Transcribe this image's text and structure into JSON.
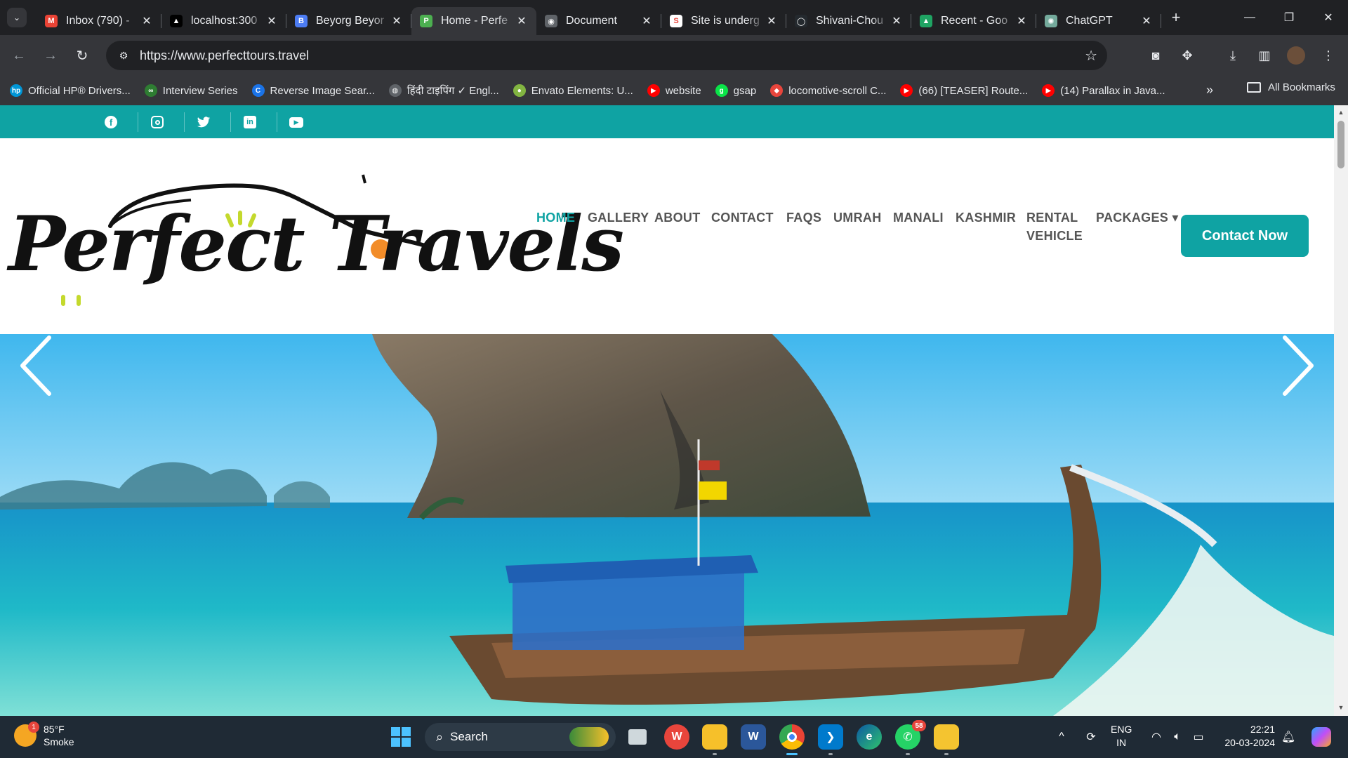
{
  "browser": {
    "tabs": [
      {
        "label": "Inbox (790) -",
        "favicon": "gmail-icon",
        "color": "#ea4335",
        "glyph": "M"
      },
      {
        "label": "localhost:300",
        "favicon": "vercel-triangle-icon",
        "color": "#000000",
        "glyph": "▲"
      },
      {
        "label": "Beyorg Beyor",
        "favicon": "beyorg-icon",
        "color": "#4c7cf3",
        "glyph": "B"
      },
      {
        "label": "Home - Perfe",
        "favicon": "perfect-travels-icon",
        "color": "#4caf50",
        "glyph": "P",
        "active": true
      },
      {
        "label": "Document",
        "favicon": "globe-icon",
        "color": "#5f6368",
        "glyph": "◉"
      },
      {
        "label": "Site is underg",
        "favicon": "site-icon",
        "color": "#ffffff",
        "glyph": "S"
      },
      {
        "label": "Shivani-Chou",
        "favicon": "github-icon",
        "color": "#24292e",
        "glyph": "◯"
      },
      {
        "label": "Recent - Goo",
        "favicon": "google-drive-icon",
        "color": "#1fa463",
        "glyph": "▲"
      },
      {
        "label": "ChatGPT",
        "favicon": "chatgpt-icon",
        "color": "#74aa9c",
        "glyph": "✺"
      }
    ],
    "url": "https://www.perfecttours.travel",
    "bookmarks": [
      {
        "label": "Official HP® Drivers...",
        "icon": "hp-icon",
        "color": "#0096d6",
        "glyph": "hp"
      },
      {
        "label": "Interview Series",
        "icon": "interview-icon",
        "color": "#2e7d32",
        "glyph": "∞"
      },
      {
        "label": "Reverse Image Sear...",
        "icon": "reverse-image-icon",
        "color": "#1a73e8",
        "glyph": "C"
      },
      {
        "label": "हिंदी टाइपिंग ✓ Engl...",
        "icon": "hindi-typing-icon",
        "color": "#5f6368",
        "glyph": "◍"
      },
      {
        "label": "Envato Elements: U...",
        "icon": "envato-icon",
        "color": "#82b541",
        "glyph": "●"
      },
      {
        "label": "website",
        "icon": "youtube-icon",
        "color": "#ff0000",
        "glyph": "▶"
      },
      {
        "label": "gsap",
        "icon": "gsap-icon",
        "color": "#0ae448",
        "glyph": "g"
      },
      {
        "label": "locomotive-scroll C...",
        "icon": "locomotive-icon",
        "color": "#e8453c",
        "glyph": "◆"
      },
      {
        "label": "(66) [TEASER] Route...",
        "icon": "youtube-icon",
        "color": "#ff0000",
        "glyph": "▶"
      },
      {
        "label": "(14) Parallax in Java...",
        "icon": "youtube-icon",
        "color": "#ff0000",
        "glyph": "▶"
      }
    ],
    "all_bookmarks_label": "All Bookmarks"
  },
  "site": {
    "brand": "Perfect Travels",
    "nav": [
      {
        "label": "HOME",
        "active": true
      },
      {
        "label": "GALLERY"
      },
      {
        "label": "ABOUT"
      },
      {
        "label": "CONTACT"
      },
      {
        "label": "FAQS"
      },
      {
        "label": "UMRAH"
      },
      {
        "label": "MANALI"
      },
      {
        "label": "KASHMIR"
      },
      {
        "label": "RENTAL VEHICLE"
      },
      {
        "label": "PACKAGES ▾"
      }
    ],
    "cta_label": "Contact Now",
    "social": [
      "facebook-icon",
      "instagram-icon",
      "twitter-icon",
      "linkedin-icon",
      "youtube-icon"
    ],
    "accent": "#0fa3a3"
  },
  "taskbar": {
    "weather_temp": "85°F",
    "weather_desc": "Smoke",
    "weather_badge": "1",
    "search_label": "Search",
    "whatsapp_count": "58",
    "lang_top": "ENG",
    "lang_bottom": "IN",
    "time": "22:21",
    "date": "20-03-2024"
  }
}
